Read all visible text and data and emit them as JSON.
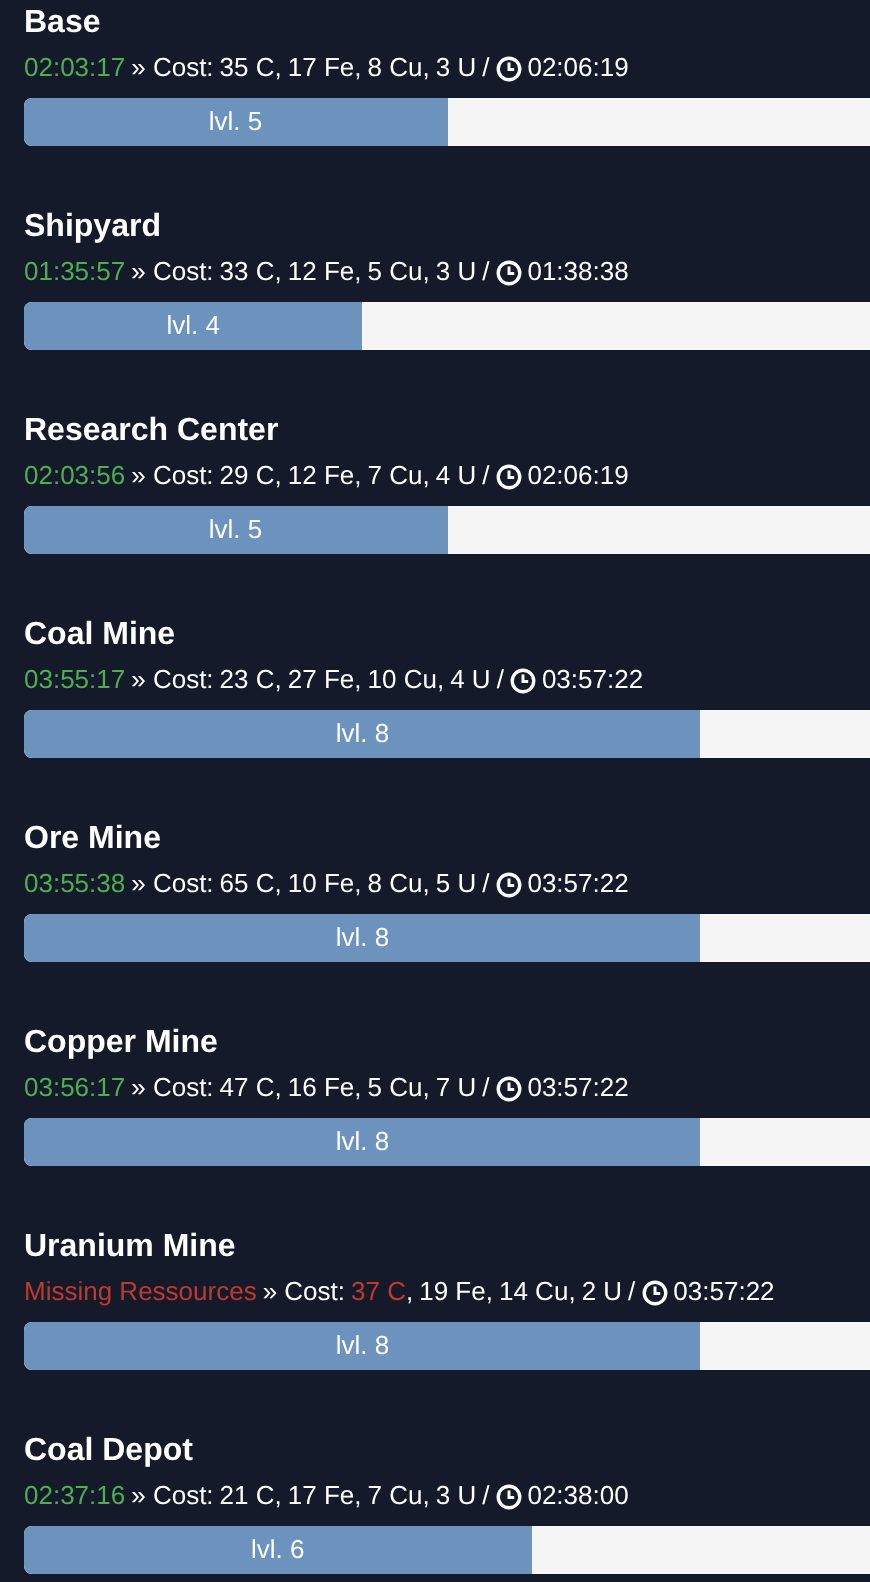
{
  "buildings": [
    {
      "name": "Base",
      "status": {
        "kind": "ready",
        "text": "02:03:17"
      },
      "cost_label": "» Cost:",
      "costs": [
        {
          "text": "35 C",
          "missing": false,
          "separator": ","
        },
        {
          "text": "17 Fe",
          "missing": false,
          "separator": ","
        },
        {
          "text": "8 Cu",
          "missing": false,
          "separator": ","
        },
        {
          "text": "3 U",
          "missing": false
        }
      ],
      "separator": "/",
      "duration": "02:06:19",
      "level_label": "lvl. 5",
      "level": 0.5
    },
    {
      "name": "Shipyard",
      "status": {
        "kind": "ready",
        "text": "01:35:57"
      },
      "cost_label": "» Cost:",
      "costs": [
        {
          "text": "33 C",
          "missing": false,
          "separator": ","
        },
        {
          "text": "12 Fe",
          "missing": false,
          "separator": ","
        },
        {
          "text": "5 Cu",
          "missing": false,
          "separator": ","
        },
        {
          "text": "3 U",
          "missing": false
        }
      ],
      "separator": "/",
      "duration": "01:38:38",
      "level_label": "lvl. 4",
      "level": 0.4
    },
    {
      "name": "Research Center",
      "status": {
        "kind": "ready",
        "text": "02:03:56"
      },
      "cost_label": "» Cost:",
      "costs": [
        {
          "text": "29 C",
          "missing": false,
          "separator": ","
        },
        {
          "text": "12 Fe",
          "missing": false,
          "separator": ","
        },
        {
          "text": "7 Cu",
          "missing": false,
          "separator": ","
        },
        {
          "text": "4 U",
          "missing": false
        }
      ],
      "separator": "/",
      "duration": "02:06:19",
      "level_label": "lvl. 5",
      "level": 0.5
    },
    {
      "name": "Coal Mine",
      "status": {
        "kind": "ready",
        "text": "03:55:17"
      },
      "cost_label": "» Cost:",
      "costs": [
        {
          "text": "23 C",
          "missing": false,
          "separator": ","
        },
        {
          "text": "27 Fe",
          "missing": false,
          "separator": ","
        },
        {
          "text": "10 Cu",
          "missing": false,
          "separator": ","
        },
        {
          "text": "4 U",
          "missing": false
        }
      ],
      "separator": "/",
      "duration": "03:57:22",
      "level_label": "lvl. 8",
      "level": 0.8
    },
    {
      "name": "Ore Mine",
      "status": {
        "kind": "ready",
        "text": "03:55:38"
      },
      "cost_label": "» Cost:",
      "costs": [
        {
          "text": "65 C",
          "missing": false,
          "separator": ","
        },
        {
          "text": "10 Fe",
          "missing": false,
          "separator": ","
        },
        {
          "text": "8 Cu",
          "missing": false,
          "separator": ","
        },
        {
          "text": "5 U",
          "missing": false
        }
      ],
      "separator": "/",
      "duration": "03:57:22",
      "level_label": "lvl. 8",
      "level": 0.8
    },
    {
      "name": "Copper Mine",
      "status": {
        "kind": "ready",
        "text": "03:56:17"
      },
      "cost_label": "» Cost:",
      "costs": [
        {
          "text": "47 C",
          "missing": false,
          "separator": ","
        },
        {
          "text": "16 Fe",
          "missing": false,
          "separator": ","
        },
        {
          "text": "5 Cu",
          "missing": false,
          "separator": ","
        },
        {
          "text": "7 U",
          "missing": false
        }
      ],
      "separator": "/",
      "duration": "03:57:22",
      "level_label": "lvl. 8",
      "level": 0.8
    },
    {
      "name": "Uranium Mine",
      "status": {
        "kind": "missing",
        "text": "Missing Ressources"
      },
      "cost_label": "» Cost:",
      "costs": [
        {
          "text": "37 C",
          "missing": true,
          "separator": ","
        },
        {
          "text": "19 Fe",
          "missing": false,
          "separator": ","
        },
        {
          "text": "14 Cu",
          "missing": false,
          "separator": ","
        },
        {
          "text": "2 U",
          "missing": false
        }
      ],
      "separator": "/",
      "duration": "03:57:22",
      "level_label": "lvl. 8",
      "level": 0.8
    },
    {
      "name": "Coal Depot",
      "status": {
        "kind": "ready",
        "text": "02:37:16"
      },
      "cost_label": "» Cost:",
      "costs": [
        {
          "text": "21 C",
          "missing": false,
          "separator": ","
        },
        {
          "text": "17 Fe",
          "missing": false,
          "separator": ","
        },
        {
          "text": "7 Cu",
          "missing": false,
          "separator": ","
        },
        {
          "text": "3 U",
          "missing": false
        }
      ],
      "separator": "/",
      "duration": "02:38:00",
      "level_label": "lvl. 6",
      "level": 0.6
    }
  ]
}
